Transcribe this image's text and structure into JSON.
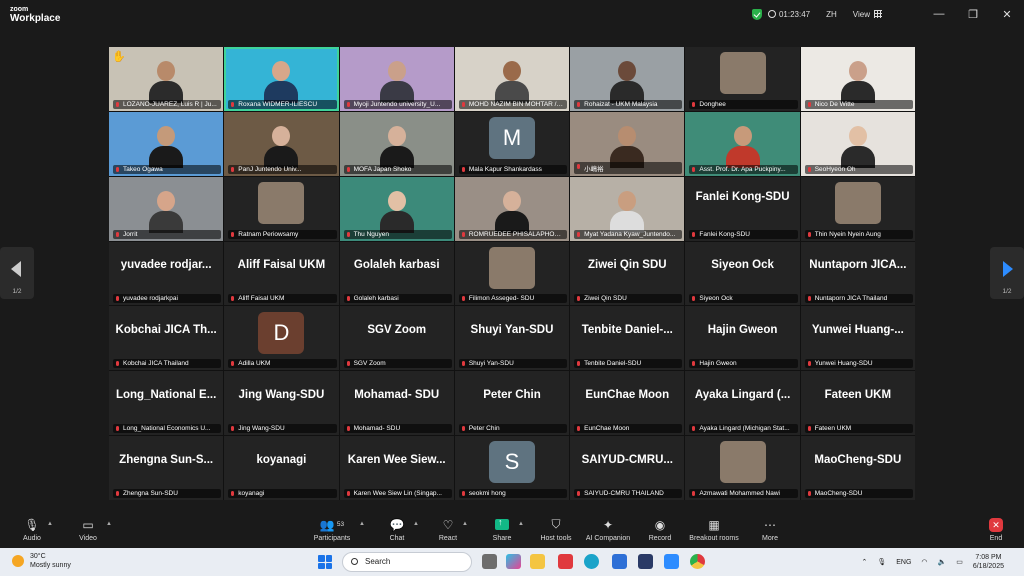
{
  "app": {
    "brand_small": "zoom",
    "brand_big": "Workplace"
  },
  "header": {
    "timer": "01:23:47",
    "language": "ZH",
    "view_label": "View",
    "win_minimize": "—",
    "win_restore": "❐",
    "win_close": "✕"
  },
  "tiles": [
    {
      "type": "video",
      "label": "LOZANO-JUAREZ, Luis R | Ju...",
      "hand": true,
      "bg": "#c8c2b5",
      "skin": "#b88a6a",
      "shirt": "#2b2b2b"
    },
    {
      "type": "video",
      "label": "Roxana WIDMER-ILIESCU",
      "active": true,
      "bg": "#34b4d6",
      "skin": "#d7a78a",
      "shirt": "#1e3a5f"
    },
    {
      "type": "video",
      "label": "Myoji Juntendo university_U...",
      "bg": "#b59bc9",
      "skin": "#caa08a",
      "shirt": "#3a3a45"
    },
    {
      "type": "video",
      "label": "MOHD NAZIM BIN MOHTAR / E...",
      "bg": "#d7d2c8",
      "skin": "#9a6a4a",
      "shirt": "#4a4a4a"
    },
    {
      "type": "video",
      "label": "Rohaizat - UKM Malaysia",
      "bg": "#9aa0a4",
      "skin": "#6b4a3a",
      "shirt": "#2a2a2a"
    },
    {
      "type": "photo",
      "label": "Donghee",
      "bg": "#232323"
    },
    {
      "type": "video",
      "label": "Nico De Witte",
      "bg": "#ece9e4",
      "skin": "#caa08a",
      "shirt": "#2a2a2a"
    },
    {
      "type": "video",
      "label": "Takeo Ogawa",
      "bg": "#5b9bd5",
      "skin": "#c49a7a",
      "shirt": "#1a1a1a"
    },
    {
      "type": "video",
      "label": "PanJ Juntendo Univ...",
      "bg": "#6d5a45",
      "skin": "#d6b19a",
      "shirt": "#1a1a1a"
    },
    {
      "type": "video",
      "label": "MOFA Japan Shoko",
      "bg": "#8a8f88",
      "skin": "#d6b19a",
      "shirt": "#1a1a1a"
    },
    {
      "type": "avatar",
      "label": "Mala Kapur Shankardass",
      "letter": "M",
      "avcolor": "#5f7380"
    },
    {
      "type": "video",
      "label": "小嶋裕",
      "bg": "#9a8c80",
      "skin": "#b78d70",
      "shirt": "#3a2a20"
    },
    {
      "type": "video",
      "label": "Asst. Prof. Dr. Apa Puckpiny...",
      "bg": "#3f8c78",
      "skin": "#c79a7a",
      "shirt": "#c0392b"
    },
    {
      "type": "video",
      "label": "SeoHyeon Oh",
      "bg": "#e6e2dd",
      "skin": "#e2c0a5",
      "shirt": "#2a2a2a"
    },
    {
      "type": "video",
      "label": "Jorrit",
      "bg": "#8b8f93",
      "skin": "#d6a58a",
      "shirt": "#3a3a3a"
    },
    {
      "type": "photo",
      "label": "Ratnam Periowsamy",
      "bg": "#232323"
    },
    {
      "type": "video",
      "label": "Thu Nguyen",
      "bg": "#3c8a7a",
      "skin": "#e2c0a5",
      "shirt": "#2a2a2a"
    },
    {
      "type": "video",
      "label": "ROMRUEDEE PHISALAPHONG",
      "bg": "#9a8f86",
      "skin": "#d6b19a",
      "shirt": "#1a1a1a"
    },
    {
      "type": "video",
      "label": "Myat Yadana Kyaw_Juntendo...",
      "bg": "#b7b0a6",
      "skin": "#c99e80",
      "shirt": "#ddd"
    },
    {
      "type": "name",
      "label": "Fanlei Kong-SDU",
      "big": "Fanlei Kong-SDU",
      "bigtop": "top"
    },
    {
      "type": "photo",
      "label": "Thin Nyein Nyein Aung",
      "bg": "#232323"
    },
    {
      "type": "name",
      "label": "yuvadee  rodjarkpai",
      "big": "yuvadee  rodjar..."
    },
    {
      "type": "name",
      "label": "Aliff Faisal UKM",
      "big": "Aliff Faisal UKM"
    },
    {
      "type": "name",
      "label": "Golaleh karbasi",
      "big": "Golaleh karbasi"
    },
    {
      "type": "photo",
      "label": "Filimon Asseged- SDU",
      "bg": "#232323"
    },
    {
      "type": "name",
      "label": "Ziwei Qin SDU",
      "big": "Ziwei Qin SDU"
    },
    {
      "type": "name",
      "label": "Siyeon Ock",
      "big": "Siyeon Ock"
    },
    {
      "type": "name",
      "label": "Nuntaporn JICA Thailand",
      "big": "Nuntaporn JICA..."
    },
    {
      "type": "name",
      "label": "Kobchai JICA Thailand",
      "big": "Kobchai JICA Th..."
    },
    {
      "type": "avatar",
      "label": "Adilla UKM",
      "letter": "D",
      "avcolor": "#6b3f2f"
    },
    {
      "type": "name",
      "label": "SGV Zoom",
      "big": "SGV Zoom"
    },
    {
      "type": "name",
      "label": "Shuyi Yan-SDU",
      "big": "Shuyi Yan-SDU"
    },
    {
      "type": "name",
      "label": "Tenbite Daniel-SDU",
      "big": "Tenbite  Daniel-..."
    },
    {
      "type": "name",
      "label": "Hajin Gweon",
      "big": "Hajin Gweon"
    },
    {
      "type": "name",
      "label": "Yunwei Huang-SDU",
      "big": "Yunwei Huang-..."
    },
    {
      "type": "name",
      "label": "Long_National Economics U...",
      "big": "Long_National  E..."
    },
    {
      "type": "name",
      "label": "Jing Wang-SDU",
      "big": "Jing Wang-SDU"
    },
    {
      "type": "name",
      "label": "Mohamad- SDU",
      "big": "Mohamad- SDU"
    },
    {
      "type": "name",
      "label": "Peter Chin",
      "big": "Peter Chin"
    },
    {
      "type": "name",
      "label": "EunChae Moon",
      "big": "EunChae Moon"
    },
    {
      "type": "name",
      "label": "Ayaka Lingard (Michigan Stat...",
      "big": "Ayaka Lingard (..."
    },
    {
      "type": "name",
      "label": "Fateen UKM",
      "big": "Fateen UKM"
    },
    {
      "type": "name",
      "label": "Zhengna Sun-SDU",
      "big": "Zhengna Sun-S..."
    },
    {
      "type": "name",
      "label": "koyanagi",
      "big": "koyanagi"
    },
    {
      "type": "name",
      "label": "Karen Wee Siew Lin (Singap...",
      "big": "Karen Wee Siew..."
    },
    {
      "type": "avatar",
      "label": "seokmi hong",
      "letter": "S",
      "avcolor": "#5f7380"
    },
    {
      "type": "name",
      "label": "SAIYUD-CMRU THAILAND",
      "big": "SAIYUD-CMRU..."
    },
    {
      "type": "photo",
      "label": "Azmawati Mohammed Nawi",
      "bg": "#232323"
    },
    {
      "type": "name",
      "label": "MaoCheng-SDU",
      "big": "MaoCheng-SDU"
    }
  ],
  "pager": {
    "left": "1/2",
    "right": "1/2"
  },
  "toolbar": {
    "audio": "Audio",
    "video": "Video",
    "participants": "Participants",
    "participants_count": "53",
    "chat": "Chat",
    "react": "React",
    "share": "Share",
    "host_tools": "Host tools",
    "ai_companion": "AI Companion",
    "record": "Record",
    "breakout": "Breakout rooms",
    "more": "More",
    "end": "End"
  },
  "taskbar": {
    "temp": "30°C",
    "weather": "Mostly sunny",
    "search": "Search",
    "lang": "ENG",
    "time": "7:08 PM",
    "date": "6/18/2025"
  }
}
